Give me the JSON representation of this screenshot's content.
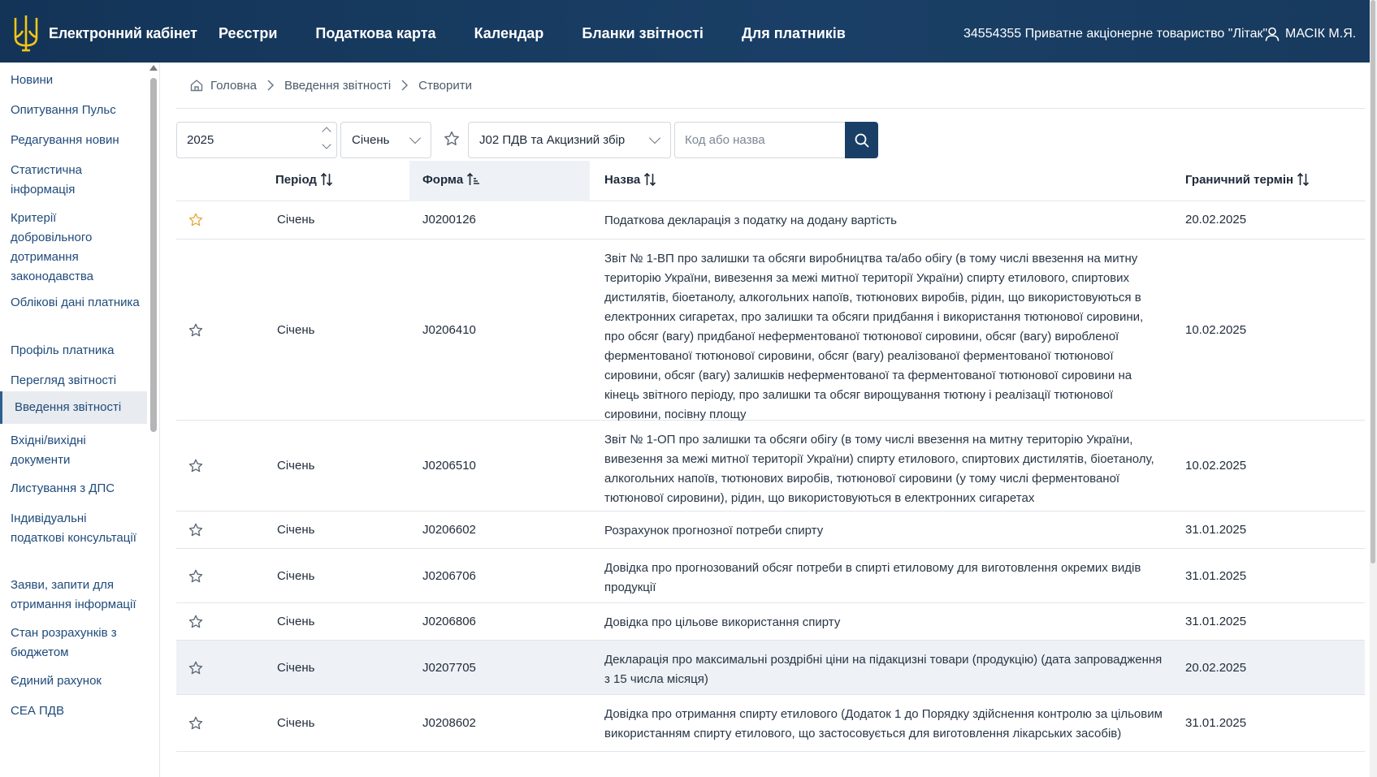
{
  "header": {
    "brand": "Електронний кабінет",
    "nav": [
      "Реєстри",
      "Податкова карта",
      "Календар",
      "Бланки звітності",
      "Для платників"
    ],
    "company": "34554355 Приватне акціонерне товариство \"Літак\"",
    "user": "МАСІК М.Я.",
    "colors": {
      "bar": "#173a5e",
      "accent": "#1a3f66",
      "star_active": "#e8a93a"
    }
  },
  "sidebar": {
    "items": [
      "Новини",
      "Опитування Пульс",
      "Редагування новин",
      "Статистична інформація",
      "Критерії добровільного дотримання законодавства",
      "Облікові дані платника",
      "Профіль платника",
      "Перегляд звітності",
      "Введення звітності",
      "Вхідні/вихідні документи",
      "Листування з ДПС",
      "Індивідуальні податкові консультації",
      "Заяви, запити для отримання інформації",
      "Стан розрахунків з бюджетом",
      "Єдиний рахунок",
      "СЕА ПДВ"
    ],
    "active_index": 8
  },
  "breadcrumb": {
    "items": [
      "Головна",
      "Введення звітності",
      "Створити"
    ]
  },
  "filters": {
    "year": "2025",
    "month": "Січень",
    "group": "J02 ПДВ та Акцизний збір",
    "search_placeholder": "Код або назва",
    "search_value": ""
  },
  "table": {
    "columns": {
      "period": "Період",
      "form": "Форма",
      "name": "Назва",
      "deadline": "Граничний термін"
    },
    "rows": [
      {
        "favorite": true,
        "period": "Січень",
        "form": "J0200126",
        "name": "Податкова декларація з податку на додану вартість",
        "deadline": "20.02.2025"
      },
      {
        "favorite": false,
        "period": "Січень",
        "form": "J0206410",
        "name": "Звіт № 1-ВП про залишки та обсяги виробництва та/або обігу (в тому числі ввезення на митну територію України, вивезення за межі митної території України) спирту етилового, спиртових дистилятів, біоетанолу, алкогольних напоїв, тютюнових виробів, рідин, що використовуються в електронних сигаретах, про залишки та обсяги придбання і використання тютюнової сировини, про обсяг (вагу) придбаної неферментованої тютюнової сировини, обсяг (вагу) виробленої ферментованої тютюнової сировини, обсяг (вагу) реалізованої ферментованої тютюнової сировини, обсяг (вагу) залишків неферментованої та ферментованої тютюнової сировини на кінець звітного періоду, про залишки та обсяг вирощування тютюну і реалізації тютюнової сировини, посівну площу",
        "deadline": "10.02.2025"
      },
      {
        "favorite": false,
        "period": "Січень",
        "form": "J0206510",
        "name": "Звіт № 1-ОП про залишки та обсяги обігу (в тому числі ввезення на митну територію України, вивезення за межі митної території України) спирту етилового, спиртових дистилятів, біоетанолу, алкогольних напоїв, тютюнових виробів, тютюнової сировини (у тому числі ферментованої тютюнової сировини), рідин, що використовуються в електронних сигаретах",
        "deadline": "10.02.2025"
      },
      {
        "favorite": false,
        "period": "Січень",
        "form": "J0206602",
        "name": "Розрахунок прогнозної потреби спирту",
        "deadline": "31.01.2025"
      },
      {
        "favorite": false,
        "period": "Січень",
        "form": "J0206706",
        "name": "Довідка про прогнозований обсяг потреби в спирті етиловому для виготовлення окремих видів продукції",
        "deadline": "31.01.2025"
      },
      {
        "favorite": false,
        "period": "Січень",
        "form": "J0206806",
        "name": "Довідка про цільове використання спирту",
        "deadline": "31.01.2025"
      },
      {
        "favorite": false,
        "period": "Січень",
        "form": "J0207705",
        "name": "Декларація про максимальні роздрібні ціни на підакцизні товари (продукцію) (дата запровадження з 15 числа місяця)",
        "deadline": "20.02.2025"
      },
      {
        "favorite": false,
        "period": "Січень",
        "form": "J0208602",
        "name": "Довідка про отримання спирту етилового (Додаток 1 до Порядку здійснення контролю за цільовим використанням спирту етилового, що застосовується для виготовлення лікарських засобів)",
        "deadline": "31.01.2025"
      }
    ]
  }
}
